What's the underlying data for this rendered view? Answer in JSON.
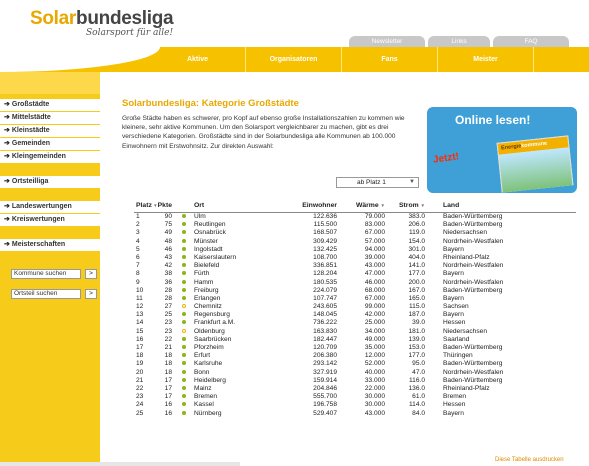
{
  "logo": {
    "word1": "Solar",
    "word2": "bundesliga",
    "slogan": "Solarsport für alle!"
  },
  "top_tabs": [
    "Newsletter",
    "Links",
    "FAQ"
  ],
  "nav": [
    "Aktive",
    "Organisatoren",
    "Fans",
    "Meister"
  ],
  "sidebar": {
    "group1": [
      "Großstädte",
      "Mittelstädte",
      "Kleinstädte",
      "Gemeinden",
      "Kleingemeinden"
    ],
    "group2": [
      "Ortsteilliga"
    ],
    "group3": [
      "Landeswertungen",
      "Kreiswertungen"
    ],
    "group4": [
      "Meisterschaften"
    ],
    "search1": "Kommune suchen",
    "search2": "Ortsteil suchen",
    "go": ">"
  },
  "heading": {
    "prefix": "Solarbundesliga: ",
    "rest": "Kategorie Großstädte"
  },
  "intro": "Große Städte haben es schwerer, pro Kopf auf ebenso große Installationszahlen zu kommen wie kleinere, sehr aktive Kommunen. Um den Solarsport vergleichbarer zu machen, gibt es drei verschiedene Kategorien. Großstädte sind in der Solarbundesliga alle Kommunen ab 100.000 Einwohnern mit Erstwohnsitz. Zur direkten Auswahl:",
  "promo": {
    "title": "Online lesen!",
    "jetzt": "Jetzt!",
    "mag_a": "Energie",
    "mag_b": "kommune"
  },
  "select": "ab Platz 1",
  "columns": {
    "platz": "Platz",
    "pkte": "Pkte",
    "ort": "Ort",
    "einw": "Einwohner",
    "waerme": "Wärme",
    "strom": "Strom",
    "land": "Land"
  },
  "rows": [
    [
      "1",
      "90",
      "Ulm",
      "122.636",
      "79.000",
      "383.0",
      "Baden-Württemberg"
    ],
    [
      "2",
      "75",
      "Reutlingen",
      "115.500",
      "83.000",
      "206.0",
      "Baden-Württemberg"
    ],
    [
      "3",
      "49",
      "Osnabrück",
      "168.507",
      "67.000",
      "119.0",
      "Niedersachsen"
    ],
    [
      "4",
      "48",
      "Münster",
      "309.429",
      "57.000",
      "154.0",
      "Nordrhein-Westfalen"
    ],
    [
      "5",
      "46",
      "Ingolstadt",
      "132.425",
      "94.000",
      "301.0",
      "Bayern"
    ],
    [
      "6",
      "43",
      "Kaiserslautern",
      "108.700",
      "39.000",
      "404.0",
      "Rheinland-Pfalz"
    ],
    [
      "7",
      "42",
      "Bielefeld",
      "336.851",
      "43.000",
      "141.0",
      "Nordrhein-Westfalen"
    ],
    [
      "8",
      "38",
      "Fürth",
      "128.204",
      "47.000",
      "177.0",
      "Bayern"
    ],
    [
      "9",
      "36",
      "Hamm",
      "180.535",
      "46.000",
      "200.0",
      "Nordrhein-Westfalen"
    ],
    [
      "10",
      "28",
      "Freiburg",
      "224.079",
      "68.000",
      "167.0",
      "Baden-Württemberg"
    ],
    [
      "11",
      "28",
      "Erlangen",
      "107.747",
      "67.000",
      "165.0",
      "Bayern"
    ],
    [
      "12",
      "27",
      "Chemnitz",
      "243.605",
      "99.000",
      "115.0",
      "Sachsen"
    ],
    [
      "13",
      "25",
      "Regensburg",
      "148.045",
      "42.000",
      "187.0",
      "Bayern"
    ],
    [
      "14",
      "23",
      "Frankfurt a.M.",
      "736.222",
      "25.000",
      "39.0",
      "Hessen"
    ],
    [
      "15",
      "23",
      "Oldenburg",
      "163.830",
      "34.000",
      "181.0",
      "Niedersachsen"
    ],
    [
      "16",
      "22",
      "Saarbrücken",
      "182.447",
      "49.000",
      "139.0",
      "Saarland"
    ],
    [
      "17",
      "21",
      "Pforzheim",
      "120.709",
      "35.000",
      "153.0",
      "Baden-Württemberg"
    ],
    [
      "18",
      "18",
      "Erfurt",
      "206.380",
      "12.000",
      "177.0",
      "Thüringen"
    ],
    [
      "19",
      "18",
      "Karlsruhe",
      "293.142",
      "52.000",
      "95.0",
      "Baden-Württemberg"
    ],
    [
      "20",
      "18",
      "Bonn",
      "327.919",
      "40.000",
      "47.0",
      "Nordrhein-Westfalen"
    ],
    [
      "21",
      "17",
      "Heidelberg",
      "159.914",
      "33.000",
      "116.0",
      "Baden-Württemberg"
    ],
    [
      "22",
      "17",
      "Mainz",
      "204.846",
      "22.000",
      "136.0",
      "Rheinland-Pfalz"
    ],
    [
      "23",
      "17",
      "Bremen",
      "555.700",
      "30.000",
      "61.0",
      "Bremen"
    ],
    [
      "24",
      "16",
      "Kassel",
      "196.758",
      "30.000",
      "114.0",
      "Hessen"
    ],
    [
      "25",
      "16",
      "Nürnberg",
      "529.407",
      "43.000",
      "84.0",
      "Bayern"
    ]
  ],
  "hollow_rows": [
    12,
    15
  ],
  "footer_link": "Diese Tabelle ausdrucken"
}
